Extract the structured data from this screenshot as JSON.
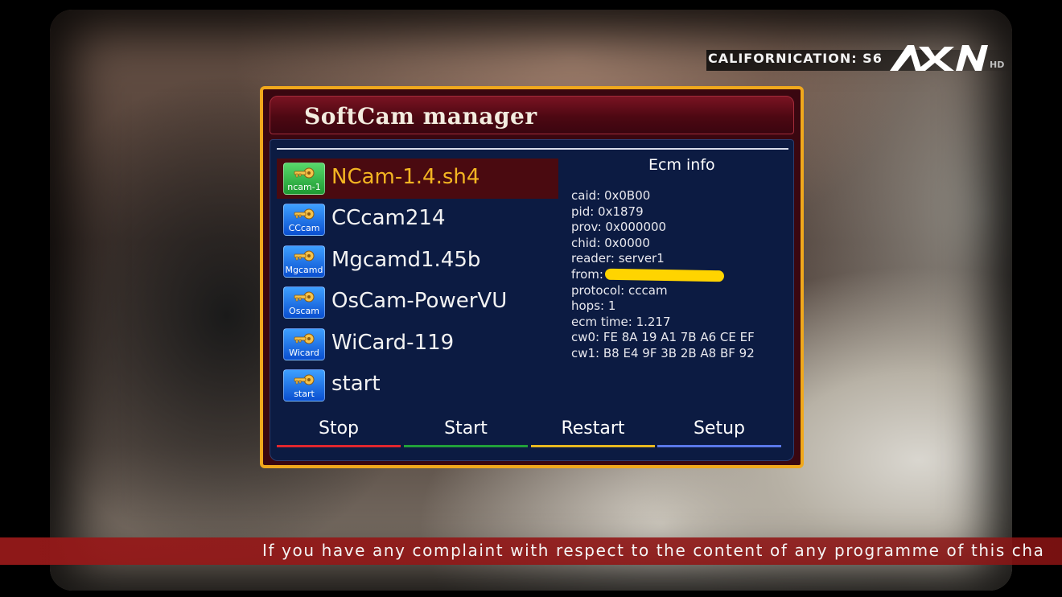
{
  "channel": {
    "show": "CALIFORNICATION: S6",
    "logo_icon": "axn-hd-logo"
  },
  "ticker": {
    "text": "If you have any complaint with respect to the content of any programme of this cha"
  },
  "dialog": {
    "title": "SoftCam manager",
    "accent_color": "#f0a81c",
    "selected_text_color": "#f3b522"
  },
  "cams": [
    {
      "name": "NCam-1.4.sh4",
      "icon_label": "ncam-1",
      "icon": "key-icon",
      "icon_color": "green",
      "selected": true
    },
    {
      "name": "CCcam214",
      "icon_label": "CCcam",
      "icon": "key-icon",
      "icon_color": "blue",
      "selected": false
    },
    {
      "name": "Mgcamd1.45b",
      "icon_label": "Mgcamd",
      "icon": "key-icon",
      "icon_color": "blue",
      "selected": false
    },
    {
      "name": "OsCam-PowerVU",
      "icon_label": "Oscam",
      "icon": "key-icon",
      "icon_color": "blue",
      "selected": false
    },
    {
      "name": "WiCard-119",
      "icon_label": "Wicard",
      "icon": "key-icon",
      "icon_color": "blue",
      "selected": false
    },
    {
      "name": "start",
      "icon_label": "start",
      "icon": "key-icon",
      "icon_color": "blue",
      "selected": false
    }
  ],
  "ecm": {
    "title": "Ecm info",
    "lines": [
      "caid: 0x0B00",
      "pid: 0x1879",
      "prov: 0x000000",
      "chid: 0x0000",
      "reader: server1",
      "from:",
      "protocol: cccam",
      "hops: 1",
      "ecm time: 1.217",
      "cw0: FE 8A 19 A1 7B A6 CE EF",
      "cw1: B8 E4 9F 3B 2B A8 BF 92"
    ]
  },
  "buttons": [
    {
      "label": "Stop",
      "color": "#e0262e"
    },
    {
      "label": "Start",
      "color": "#22a03a"
    },
    {
      "label": "Restart",
      "color": "#e8b820"
    },
    {
      "label": "Setup",
      "color": "#5a78e8"
    }
  ]
}
